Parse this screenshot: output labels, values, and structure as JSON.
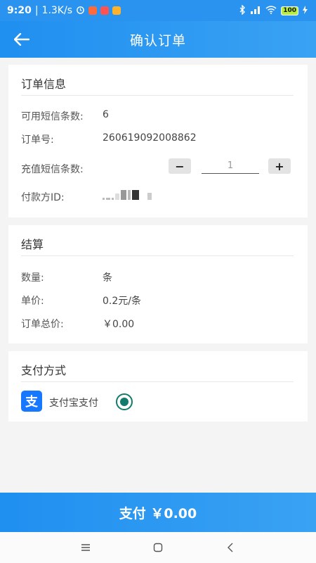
{
  "status_bar": {
    "time": "9:20",
    "speed": "1.3K/s",
    "battery": "100"
  },
  "header": {
    "title": "确认订单"
  },
  "order_info": {
    "title": "订单信息",
    "available_label": "可用短信条数:",
    "available_value": "6",
    "order_no_label": "订单号:",
    "order_no_value": "260619092008862",
    "recharge_label": "充值短信条数:",
    "recharge_value": "1",
    "payer_label": "付款方ID:"
  },
  "settlement": {
    "title": "结算",
    "quantity_label": "数量:",
    "quantity_value": "条",
    "unit_price_label": "单价:",
    "unit_price_value": "0.2元/条",
    "total_label": "订单总价:",
    "total_value": "￥0.00"
  },
  "payment": {
    "title": "支付方式",
    "alipay_label": "支付宝支付",
    "alipay_icon_text": "支"
  },
  "pay_button": {
    "label": "支付 ￥0.00"
  },
  "colors": {
    "brand": "#2a93ef",
    "radio": "#137a6e",
    "alipay": "#1677ff"
  }
}
